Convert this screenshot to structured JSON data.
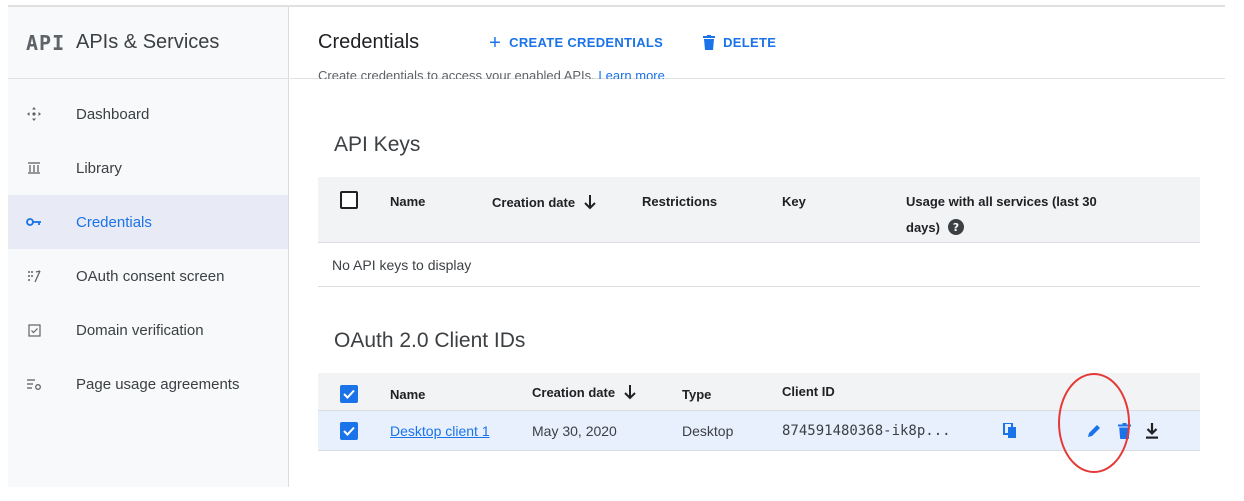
{
  "sidebar": {
    "logo": "API",
    "title": "APIs & Services",
    "items": [
      {
        "label": "Dashboard",
        "icon": "dashboard-icon"
      },
      {
        "label": "Library",
        "icon": "library-icon"
      },
      {
        "label": "Credentials",
        "icon": "key-icon",
        "active": true
      },
      {
        "label": "OAuth consent screen",
        "icon": "oauth-icon"
      },
      {
        "label": "Domain verification",
        "icon": "domain-check-icon"
      },
      {
        "label": "Page usage agreements",
        "icon": "settings-list-icon"
      }
    ]
  },
  "header": {
    "title": "Credentials",
    "create_label": "CREATE CREDENTIALS",
    "delete_label": "DELETE",
    "subtitle_text": "Create credentials to access your enabled APIs.",
    "subtitle_link": "Learn more"
  },
  "api_keys": {
    "title": "API Keys",
    "columns": [
      "Name",
      "Creation date",
      "Restrictions",
      "Key",
      "Usage with all services (last 30",
      "days)"
    ],
    "empty_text": "No API keys to display"
  },
  "oauth": {
    "title": "OAuth 2.0 Client IDs",
    "columns": [
      "Name",
      "Creation date",
      "Type",
      "Client ID"
    ],
    "rows": [
      {
        "name": "Desktop client 1",
        "date": "May 30, 2020",
        "type": "Desktop",
        "client_id": "874591480368-ik8p...",
        "checked": true
      }
    ]
  },
  "colors": {
    "accent": "#1a73e8",
    "annotation": "#e53935",
    "active_bg": "#e8eaf6"
  }
}
